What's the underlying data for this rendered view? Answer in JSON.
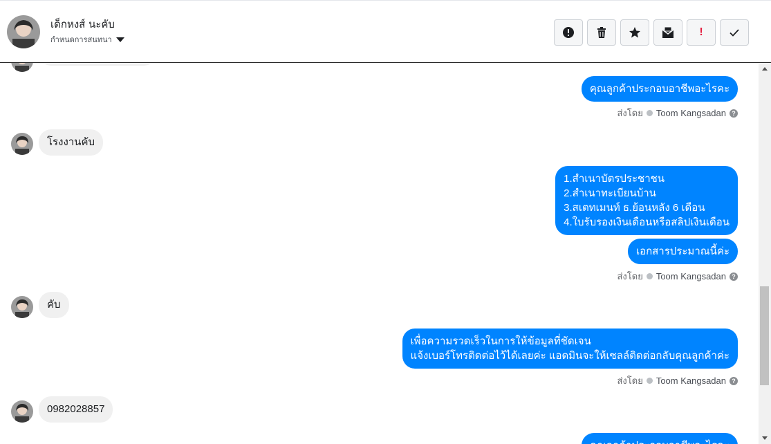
{
  "header": {
    "contact_name": "เด็กหงส์ นะคับ",
    "assign_label": "กำหนดการสนทนา",
    "actions": [
      {
        "name": "report-icon"
      },
      {
        "name": "trash-icon"
      },
      {
        "name": "star-icon"
      },
      {
        "name": "mark-unread-icon"
      },
      {
        "name": "spam-icon",
        "label": "!"
      },
      {
        "name": "done-check-icon"
      }
    ]
  },
  "messages": {
    "out1": "คุณลูกค้าประกอบอาชีพอะไรคะ",
    "in1": "โรงงานคับ",
    "out2_lines": [
      "1.สำเนาบัตรประชาชน",
      "2.สำเนาทะเบียนบ้าน",
      "3.สเตทเมนท์ ธ.ย้อนหลัง 6 เดือน",
      "4.ใบรับรองเงินเดือนหรือสลิปเงินเดือน"
    ],
    "out3": "เอกสารประมาณนี้ค่ะ",
    "in2": "คับ",
    "out4_lines": [
      "เพื่อความรวดเร็วในการให้ข้อมูลที่ชัดเจน",
      "แจ้งเบอร์โทรติดต่อไว้ได้เลยค่ะ แอดมินจะให้เซลล์ติดต่อกลับคุณลูกค้าค่ะ"
    ],
    "in3": "0982028857",
    "out5_partial": "คุณลูกค้าประกอบอาชีพอะไรคะ"
  },
  "sent_by": {
    "prefix": "ส่งโดย",
    "sender": "Toom Kangsadan",
    "help": "?"
  },
  "colors": {
    "outgoing": "#0084ff",
    "incoming": "#f0f0f0"
  }
}
